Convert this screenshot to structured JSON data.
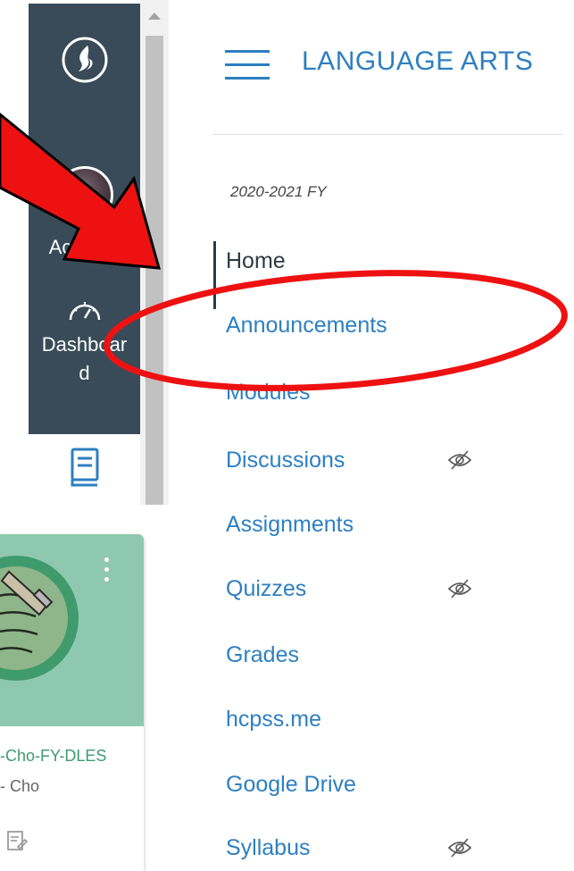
{
  "global_nav": {
    "account_label": "Account",
    "dashboard_label_line1": "Dashboar",
    "dashboard_label_line2": "d",
    "colors": {
      "background": "#394b58",
      "text": "#ffffff",
      "courses_icon": "#2d7fc1"
    }
  },
  "course": {
    "title": "LANGUAGE ARTS",
    "term": "2020-2021 FY"
  },
  "course_nav": {
    "items": [
      {
        "label": "Home",
        "active": true,
        "hidden": false
      },
      {
        "label": "Announcements",
        "active": false,
        "hidden": false
      },
      {
        "label": "Modules",
        "active": false,
        "hidden": false
      },
      {
        "label": "Discussions",
        "active": false,
        "hidden": true
      },
      {
        "label": "Assignments",
        "active": false,
        "hidden": false
      },
      {
        "label": "Quizzes",
        "active": false,
        "hidden": true
      },
      {
        "label": "Grades",
        "active": false,
        "hidden": false
      },
      {
        "label": "hcpss.me",
        "active": false,
        "hidden": false
      },
      {
        "label": "Google Drive",
        "active": false,
        "hidden": false
      },
      {
        "label": "Syllabus",
        "active": false,
        "hidden": true
      }
    ]
  },
  "course_card": {
    "code": "-Cho-FY-DLES",
    "term": "- Cho",
    "color": "#8fc8b0",
    "code_color": "#3e9a72"
  },
  "annotation": {
    "color": "#ee1111"
  }
}
